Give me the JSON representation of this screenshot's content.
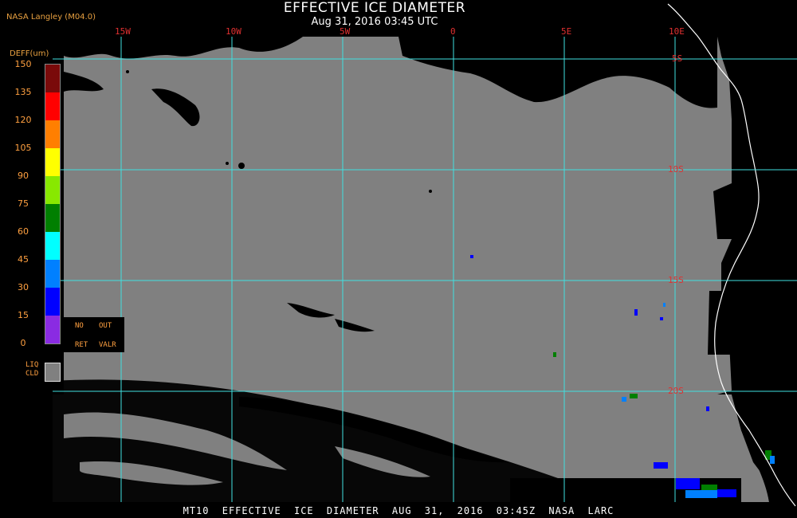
{
  "header": {
    "agency": "NASA Langley (M04.0)",
    "title": "EFFECTIVE ICE DIAMETER",
    "subtitle": "Aug 31, 2016 03:45 UTC"
  },
  "grid": {
    "longitudes": [
      "15W",
      "10W",
      "5W",
      "0",
      "5E",
      "10E"
    ],
    "latitudes": [
      "5S",
      "10S",
      "15S",
      "20S"
    ]
  },
  "legend": {
    "title": "DEFF(um)",
    "ticks": [
      "150",
      "135",
      "120",
      "105",
      "90",
      "75",
      "60",
      "45",
      "30",
      "15",
      "0"
    ],
    "colors": [
      "#7a0a0a",
      "#ff0000",
      "#ff7f00",
      "#ffff00",
      "#88e800",
      "#007f00",
      "#00ffff",
      "#0080ff",
      "#0000ff",
      "#8a2be2"
    ],
    "noret_no": "NO",
    "noret_out": "OUT",
    "noret_ret": "RET",
    "noret_valr": "VALR",
    "liq_line1": "LIQ",
    "liq_line2": "CLD"
  },
  "colors": {
    "liquid_cloud": "#808080",
    "clear_sky": "#000000",
    "grid_line": "#40e0e0",
    "coastline": "#ffffff",
    "grid_label": "#e03030"
  },
  "footer": {
    "text": "MT10 EFFECTIVE ICE DIAMETER AUG 31, 2016 03:45Z NASA LARC"
  }
}
